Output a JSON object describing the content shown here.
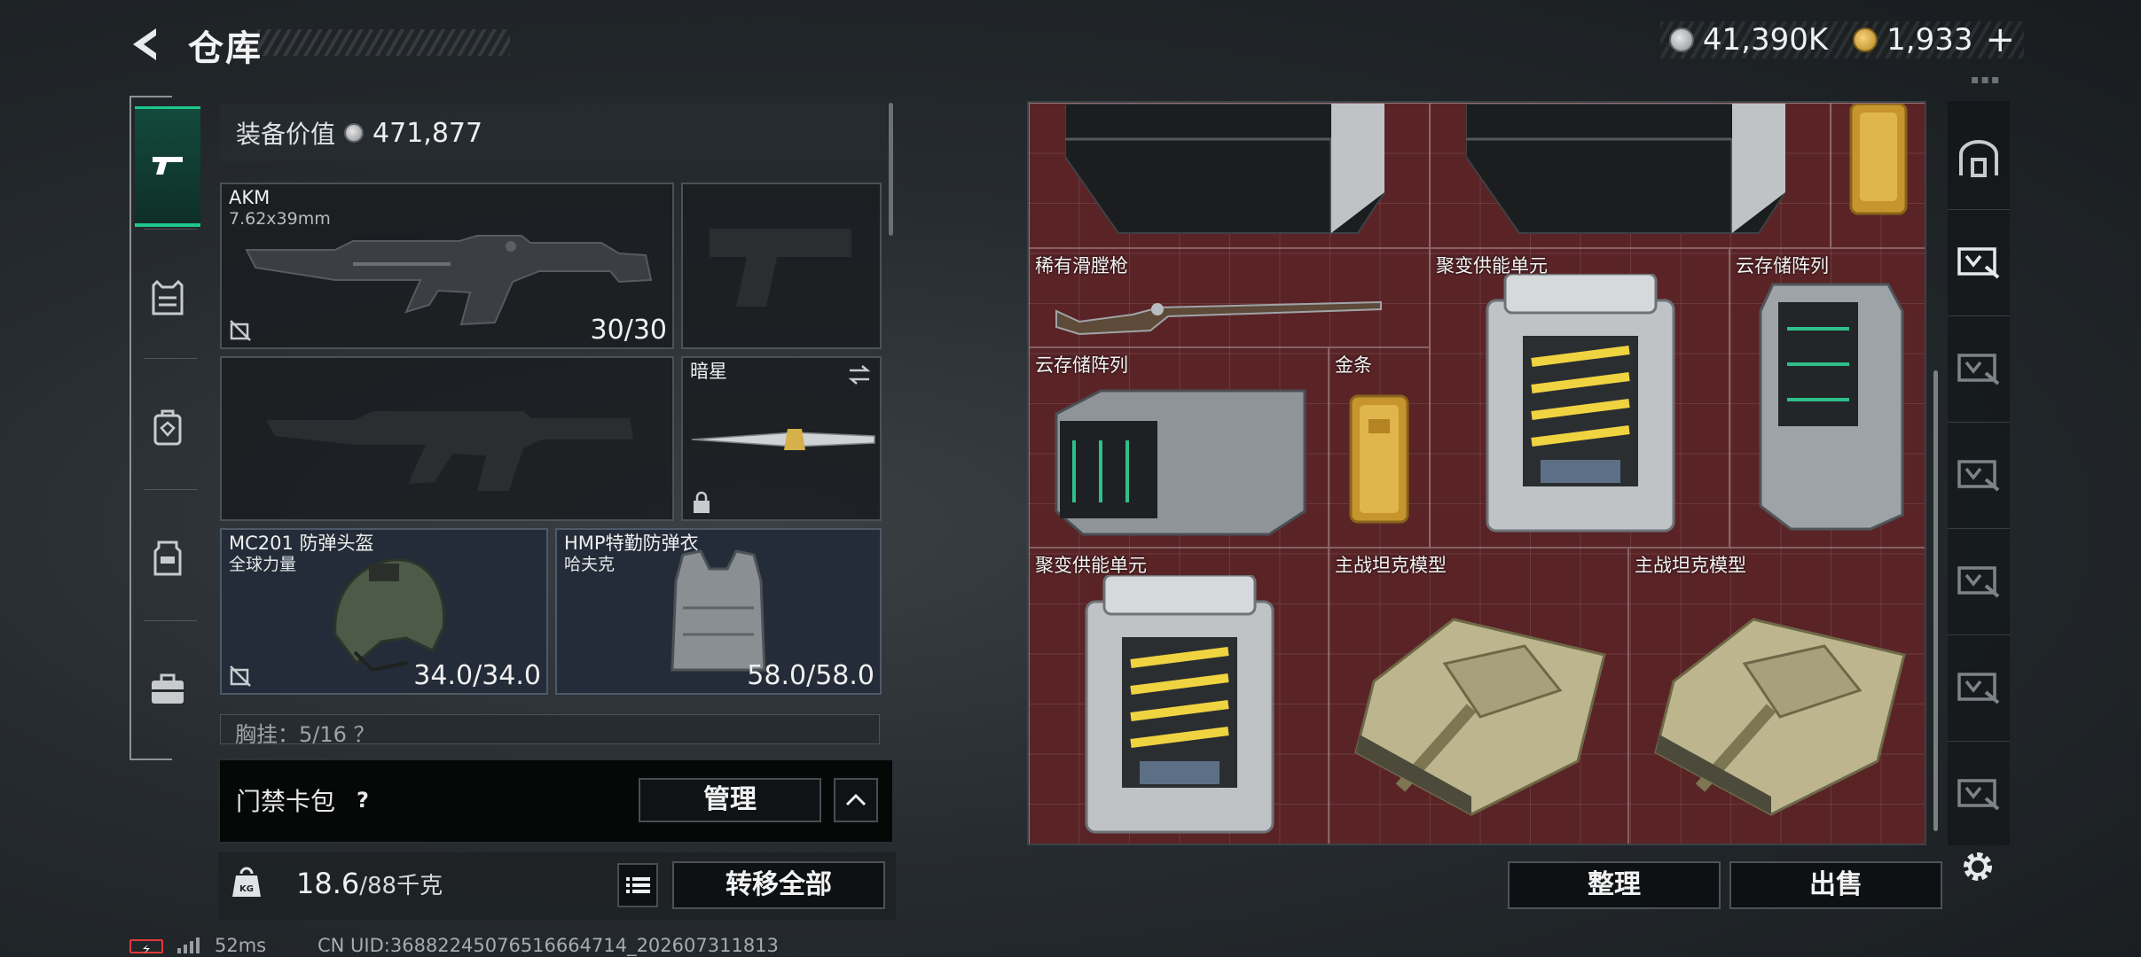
{
  "header": {
    "title": "仓库",
    "silver_amount": "41,390K",
    "gold_amount": "1,933",
    "add_label": "+"
  },
  "left_tabs": [
    "gun-icon",
    "vest-icon",
    "backpack-icon",
    "rig-icon",
    "case-icon"
  ],
  "loadout": {
    "value_label": "装备价值",
    "value": "471,877",
    "primary": {
      "name": "AKM",
      "caliber": "7.62x39mm",
      "ammo": "30/30"
    },
    "melee": {
      "name": "暗星"
    },
    "helmet": {
      "name": "MC201 防弹头盔",
      "brand": "全球力量",
      "durability": "34.0/34.0"
    },
    "armor": {
      "name": "HMP特勤防弹衣",
      "brand": "哈夫克",
      "durability": "58.0/58.0"
    },
    "pocket_row": "胸挂：5/16 ？"
  },
  "keycard": {
    "label": "门禁卡包",
    "help": "?",
    "manage_label": "管理"
  },
  "weight": {
    "current": "18.6",
    "max_with_unit": "/88千克",
    "transfer_label": "转移全部"
  },
  "status": {
    "ping": "52ms",
    "uid": "CN UID:36882245076516664714_202607311813"
  },
  "stash": {
    "items": [
      {
        "label": "稀有滑膛枪"
      },
      {
        "label": "聚变供能单元"
      },
      {
        "label": "云存储阵列"
      },
      {
        "label": "云存储阵列"
      },
      {
        "label": "金条"
      },
      {
        "label": "聚变供能单元"
      },
      {
        "label": "主战坦克模型"
      },
      {
        "label": "主战坦克模型"
      }
    ],
    "sort_label": "整理",
    "sell_label": "出售"
  },
  "right_tabs": [
    "safe-icon",
    "stash-1-icon",
    "stash-2-icon",
    "stash-3-icon",
    "stash-4-icon",
    "stash-5-icon",
    "stash-6-icon"
  ],
  "colors": {
    "accent": "#1fc88a",
    "stash_bg": "#5a2427",
    "panel_bg": "#1a1e21"
  }
}
